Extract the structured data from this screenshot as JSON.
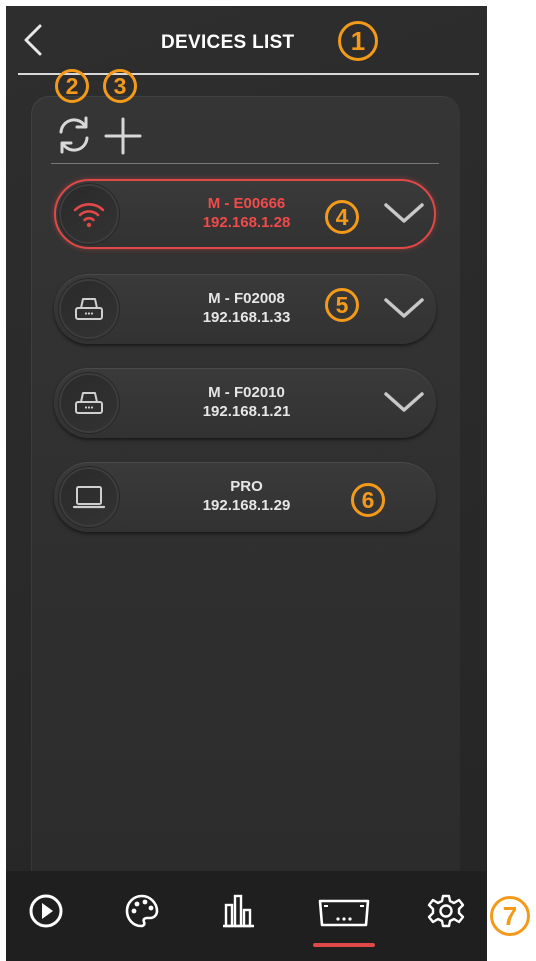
{
  "header": {
    "title": "DEVICES LIST"
  },
  "devices": [
    {
      "name": "M - E00666",
      "ip": "192.168.1.28",
      "icon": "wifi-icon",
      "selected": true
    },
    {
      "name": "M - F02008",
      "ip": "192.168.1.33",
      "icon": "printer-icon",
      "selected": false
    },
    {
      "name": "M - F02010",
      "ip": "192.168.1.21",
      "icon": "printer-icon",
      "selected": false
    },
    {
      "name": "PRO",
      "ip": "192.168.1.29",
      "icon": "laptop-icon",
      "selected": false
    }
  ],
  "bottom_nav": {
    "items": [
      "play-icon",
      "palette-icon",
      "equalizer-icon",
      "device-icon",
      "gear-icon"
    ],
    "active": "device-icon"
  },
  "callouts": [
    "1",
    "2",
    "3",
    "4",
    "5",
    "6",
    "7"
  ],
  "colors": {
    "accent_red": "#e14848",
    "callout_orange": "#f39a1a",
    "background": "#2a2a2a",
    "text": "#e6e6e6"
  }
}
